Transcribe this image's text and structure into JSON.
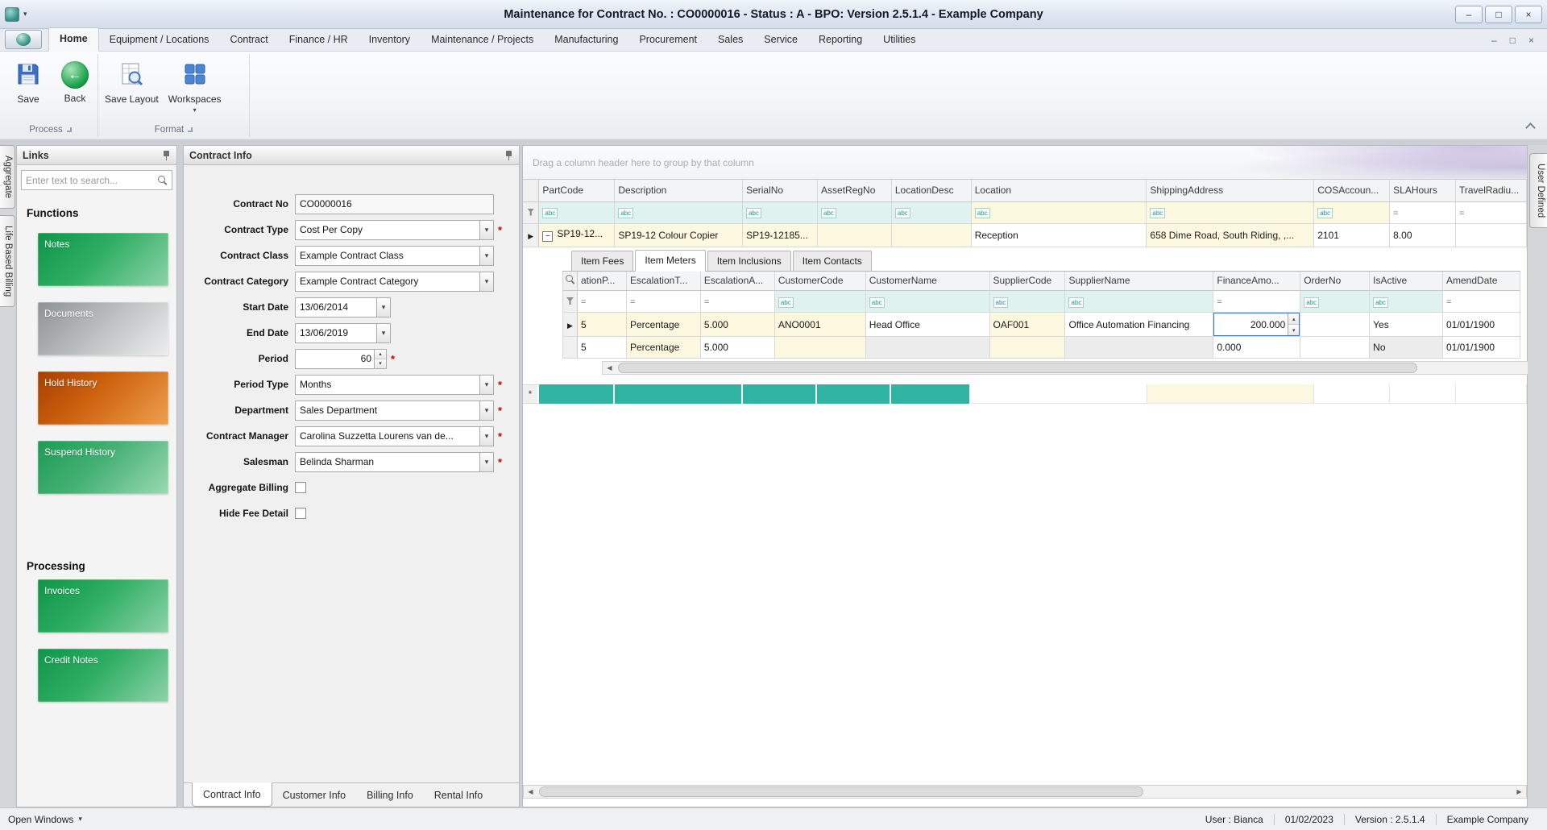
{
  "colors": {
    "accent_teal": "#2fb3a3",
    "link_green": "#0d9648",
    "link_gray": "#9b9b9b",
    "link_orange": "#a83f00",
    "required_red": "#cc0000",
    "edit_border_blue": "#3a78cf",
    "filter_cyan": "#dff2f0",
    "cell_yellow": "#fcf8e0"
  },
  "icons": {
    "qat_arrow": "▾",
    "minimize": "–",
    "maximize": "□",
    "close": "×",
    "dropdown": "▾",
    "spin_up": "▴",
    "spin_down": "▾",
    "row_arrow": "▶",
    "collapse_box": "−",
    "new_row": "*",
    "scroll_left": "◀",
    "scroll_right": "▶",
    "filter_abc": "abc",
    "filter_eq": "=",
    "back_arrow": "←",
    "workspaces_arrow": "▾",
    "open_windows_arrow": "▾"
  },
  "titlebar": {
    "title": "Maintenance for Contract No. : CO0000016 - Status : A - BPO: Version 2.5.1.4 - Example Company"
  },
  "ribbon": {
    "tabs": [
      "Home",
      "Equipment / Locations",
      "Contract",
      "Finance / HR",
      "Inventory",
      "Maintenance / Projects",
      "Manufacturing",
      "Procurement",
      "Sales",
      "Service",
      "Reporting",
      "Utilities"
    ],
    "active_tab": "Home",
    "buttons": {
      "save": "Save",
      "back": "Back",
      "save_layout": "Save Layout",
      "workspaces": "Workspaces"
    },
    "groups": {
      "process": "Process",
      "format": "Format"
    }
  },
  "side_tabs": {
    "left": [
      "Aggregate",
      "Life Based Billing"
    ],
    "right": [
      "User Defined"
    ]
  },
  "links": {
    "title": "Links",
    "search_placeholder": "Enter text to search...",
    "sections": {
      "functions": "Functions",
      "processing": "Processing"
    },
    "buttons": {
      "notes": "Notes",
      "documents": "Documents",
      "hold_history": "Hold History",
      "suspend_history": "Suspend History",
      "invoices": "Invoices",
      "credit_notes": "Credit Notes"
    }
  },
  "contract_info": {
    "title": "Contract Info",
    "required_marker": "*",
    "fields": {
      "contract_no": {
        "label": "Contract No",
        "value": "CO0000016"
      },
      "contract_type": {
        "label": "Contract Type",
        "value": "Cost Per Copy"
      },
      "contract_class": {
        "label": "Contract Class",
        "value": "Example Contract Class"
      },
      "contract_category": {
        "label": "Contract Category",
        "value": "Example Contract Category"
      },
      "start_date": {
        "label": "Start Date",
        "value": "13/06/2014"
      },
      "end_date": {
        "label": "End Date",
        "value": "13/06/2019"
      },
      "period": {
        "label": "Period",
        "value": "60"
      },
      "period_type": {
        "label": "Period Type",
        "value": "Months"
      },
      "department": {
        "label": "Department",
        "value": "Sales Department"
      },
      "contract_manager": {
        "label": "Contract Manager",
        "value": "Carolina Suzzetta Lourens van de..."
      },
      "salesman": {
        "label": "Salesman",
        "value": "Belinda Sharman"
      },
      "aggregate_billing": {
        "label": "Aggregate Billing",
        "checked": false
      },
      "hide_fee_detail": {
        "label": "Hide Fee Detail",
        "checked": false
      }
    },
    "tabs": [
      "Contract Info",
      "Customer Info",
      "Billing Info",
      "Rental Info"
    ],
    "active_tab": "Contract Info"
  },
  "grid": {
    "group_hint": "Drag a column header here to group by that column",
    "columns": [
      "PartCode",
      "Description",
      "SerialNo",
      "AssetRegNo",
      "LocationDesc",
      "Location",
      "ShippingAddress",
      "COSAccoun...",
      "SLAHours",
      "TravelRadiu..."
    ],
    "row": {
      "part_code": "SP19-12...",
      "description": "SP19-12 Colour Copier",
      "serial_no": "SP19-12185...",
      "asset_reg_no": "",
      "location_desc": "",
      "location": "Reception",
      "shipping_address": "658 Dime Road, South Riding, ,...",
      "cos_account": "2101",
      "sla_hours": "8.00",
      "travel_radius": ""
    },
    "detail": {
      "tabs": [
        "Item Fees",
        "Item Meters",
        "Item Inclusions",
        "Item Contacts"
      ],
      "active_tab": "Item Meters",
      "columns": [
        "ationP...",
        "EscalationT...",
        "EscalationA...",
        "CustomerCode",
        "CustomerName",
        "SupplierCode",
        "SupplierName",
        "FinanceAmo...",
        "OrderNo",
        "IsActive",
        "AmendDate"
      ],
      "rows": [
        {
          "escalation_period": "5",
          "escalation_type": "Percentage",
          "escalation_amount": "5.000",
          "customer_code": "ANO0001",
          "customer_name": "Head Office",
          "supplier_code": "OAF001",
          "supplier_name": "Office Automation Financing",
          "finance_amount": "200.000",
          "order_no": "",
          "is_active": "Yes",
          "amend_date": "01/01/1900"
        },
        {
          "escalation_period": "5",
          "escalation_type": "Percentage",
          "escalation_amount": "5.000",
          "customer_code": "",
          "customer_name": "",
          "supplier_code": "",
          "supplier_name": "",
          "finance_amount": "0.000",
          "order_no": "",
          "is_active": "No",
          "amend_date": "01/01/1900"
        }
      ]
    }
  },
  "statusbar": {
    "open_windows": "Open Windows",
    "user": "User : Bianca",
    "date": "01/02/2023",
    "version": "Version : 2.5.1.4",
    "company": "Example Company"
  }
}
